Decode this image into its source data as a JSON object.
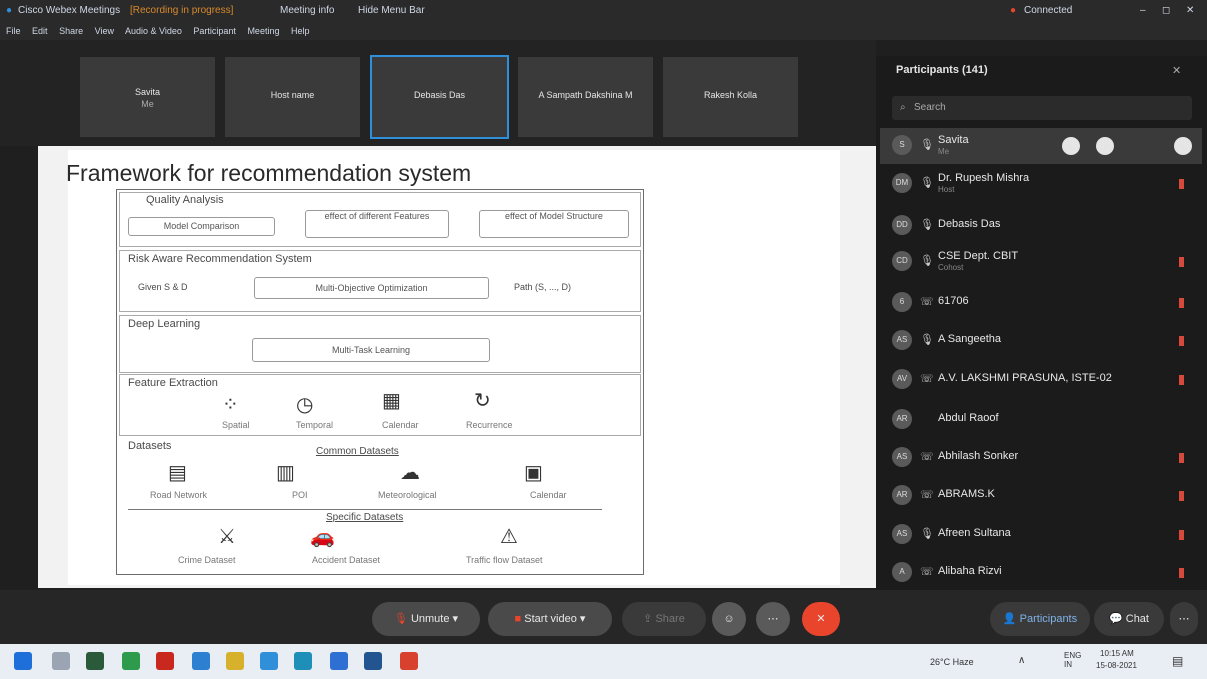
{
  "title_bar": {
    "app": "Cisco Webex Meetings",
    "recording": "[Recording in progress]",
    "meeting_info": "Meeting info",
    "hide_menu": "Hide Menu Bar",
    "status": "Connected",
    "window_controls": [
      "–",
      "◻",
      "✕"
    ]
  },
  "menu": [
    "File",
    "Edit",
    "Share",
    "View",
    "Audio & Video",
    "Participant",
    "Meeting",
    "Help"
  ],
  "video_tiles": [
    {
      "name": "Savita",
      "sub": "Me"
    },
    {
      "name": "Host name"
    },
    {
      "name": "Debasis Das",
      "active": true
    },
    {
      "name": "A Sampath Dakshina M"
    },
    {
      "name": "Rakesh Kolla"
    }
  ],
  "slide": {
    "title": "Framework for recommendation system",
    "sections": {
      "quality": {
        "heading": "Quality Analysis",
        "items": [
          "Model Comparison",
          "effect of different Features",
          "effect of Model Structure"
        ]
      },
      "risk": {
        "heading": "Risk Aware Recommendation System",
        "given": "Given S & D",
        "objective": "Multi-Objective Optimization",
        "path": "Path (S, ..., D)"
      },
      "deep": {
        "heading": "Deep Learning",
        "task": "Multi-Task Learning"
      },
      "feature": {
        "heading": "Feature Extraction",
        "items": [
          "Spatial",
          "Temporal",
          "Calendar",
          "Recurrence"
        ]
      },
      "datasets": {
        "heading": "Datasets",
        "common": "Common Datasets",
        "common_items": [
          "Road Network",
          "POI",
          "Meteorological",
          "Calendar"
        ],
        "specific": "Specific Datasets",
        "specific_items": [
          "Crime Dataset",
          "Accident Dataset",
          "Traffic flow Dataset"
        ]
      }
    }
  },
  "participants": {
    "title": "Participants (141)",
    "search_placeholder": "Search",
    "list": [
      {
        "initials": "S",
        "name": "Savita",
        "sub": "Me",
        "selected": true
      },
      {
        "initials": "DM",
        "name": "Dr. Rupesh Mishra",
        "sub": "Host"
      },
      {
        "initials": "DD",
        "name": "Debasis Das"
      },
      {
        "initials": "CD",
        "name": "CSE Dept. CBIT",
        "sub": "Cohost"
      },
      {
        "initials": "6",
        "name": "61706"
      },
      {
        "initials": "AS",
        "name": "A Sangeetha"
      },
      {
        "initials": "AV",
        "name": "A.V. LAKSHMI PRASUNA, ISTE-02"
      },
      {
        "initials": "AR",
        "name": "Abdul Raoof"
      },
      {
        "initials": "AS",
        "name": "Abhilash Sonker"
      },
      {
        "initials": "AR",
        "name": "ABRAMS.K"
      },
      {
        "initials": "AS",
        "name": "Afreen Sultana"
      },
      {
        "initials": "A",
        "name": "Alibaha Rizvi"
      }
    ]
  },
  "toolbar": {
    "unmute": "Unmute",
    "start_video": "Start video",
    "share": "Share",
    "participants": "Participants",
    "chat": "Chat"
  },
  "taskbar": {
    "weather": "26°C Haze",
    "lang": "ENG IN",
    "time": "10:15 AM",
    "date": "15-08-2021"
  },
  "colors": {
    "end_button": "#e8452c",
    "accent": "#2f8fd8",
    "mute_red": "#d54a3a"
  }
}
